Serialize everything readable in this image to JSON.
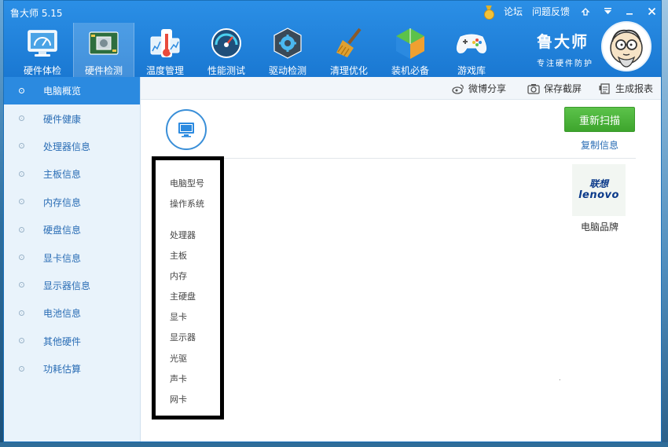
{
  "window": {
    "title": "鲁大师 5.15"
  },
  "title_bar": {
    "forum": "论坛",
    "feedback": "问题反馈",
    "icons": [
      "medal-icon",
      "skin-icon",
      "menu-icon",
      "minimize-icon",
      "close-icon"
    ]
  },
  "nav": {
    "items": [
      {
        "label": "硬件体检",
        "icon": "monitor-gauge-icon"
      },
      {
        "label": "硬件检测",
        "icon": "chip-board-icon",
        "active": true
      },
      {
        "label": "温度管理",
        "icon": "thermometer-icon"
      },
      {
        "label": "性能测试",
        "icon": "speedometer-icon"
      },
      {
        "label": "驱动检测",
        "icon": "gear-cube-icon"
      },
      {
        "label": "清理优化",
        "icon": "broom-icon"
      },
      {
        "label": "装机必备",
        "icon": "cube-icon"
      },
      {
        "label": "游戏库",
        "icon": "gamepad-icon"
      }
    ]
  },
  "brand": {
    "name": "鲁大师",
    "slogan": "专注硬件防护"
  },
  "sidebar": {
    "items": [
      {
        "label": "电脑概览",
        "active": true
      },
      {
        "label": "硬件健康"
      },
      {
        "label": "处理器信息"
      },
      {
        "label": "主板信息"
      },
      {
        "label": "内存信息"
      },
      {
        "label": "硬盘信息"
      },
      {
        "label": "显卡信息"
      },
      {
        "label": "显示器信息"
      },
      {
        "label": "电池信息"
      },
      {
        "label": "其他硬件"
      },
      {
        "label": "功耗估算"
      }
    ]
  },
  "toolbar": {
    "weibo_share": "微博分享",
    "save_screenshot": "保存截屏",
    "generate_report": "生成报表"
  },
  "content": {
    "rescan_button": "重新扫描",
    "copy_info": "复制信息",
    "info_labels": [
      "电脑型号",
      "操作系统",
      "处理器",
      "主板",
      "内存",
      "主硬盘",
      "显卡",
      "显示器",
      "光驱",
      "声卡",
      "网卡"
    ],
    "brand_logo": {
      "line1": "联想",
      "line2": "lenovo"
    },
    "brand_caption": "电脑品牌",
    "speck": "."
  },
  "colors": {
    "header": "#1f82dc",
    "sidebar_bg": "#e9f3fb",
    "sidebar_active": "#2b8ae0",
    "link": "#2a6db5",
    "rescan": "#4caf3a",
    "highlight_box": "#000000"
  }
}
